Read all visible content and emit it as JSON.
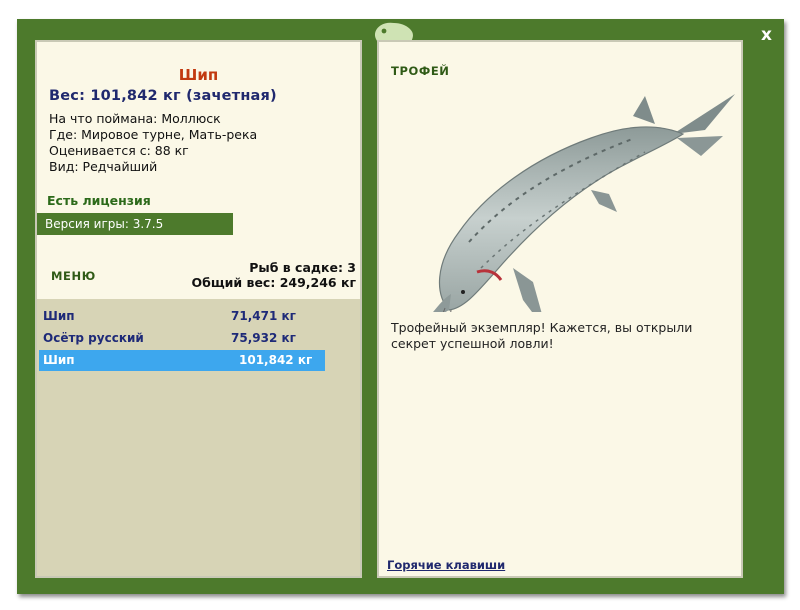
{
  "window": {
    "close_label": "x"
  },
  "fish": {
    "name": "Шип",
    "weight_line": "Вес: 101,842 кг (зачетная)",
    "bait_line": "На что поймана: Моллюск",
    "location_line": "Где: Мировое турне, Мать-река",
    "value_line": "Оценивается с: 88 кг",
    "rarity_line": "Вид: Редчайший"
  },
  "license_text": "Есть лицензия",
  "version_text": "Версия игры: 3.7.5",
  "menu_title": "МЕНЮ",
  "keep": {
    "count_line": "Рыб в садке: 3",
    "total_line": "Общий вес: 249,246 кг"
  },
  "catches": [
    {
      "name": "Шип",
      "weight": "71,471 кг"
    },
    {
      "name": "Осётр русский",
      "weight": "75,932 кг"
    },
    {
      "name": "Шип",
      "weight": "101,842 кг"
    }
  ],
  "trophy": {
    "title": "ТРОФЕЙ",
    "message": "Трофейный экземпляр! Кажется, вы открыли секрет успешной ловли!"
  },
  "hotkeys_link": "Горячие клавиши",
  "colors": {
    "frame": "#4d7a2c",
    "panel": "#fbf8e7",
    "list_bg": "#d7d4b6",
    "selected": "#3da7ee",
    "fish_name": "#c23a10",
    "weight_text": "#20296e"
  },
  "icons": [
    "chameleon-logo-icon",
    "close-icon"
  ]
}
